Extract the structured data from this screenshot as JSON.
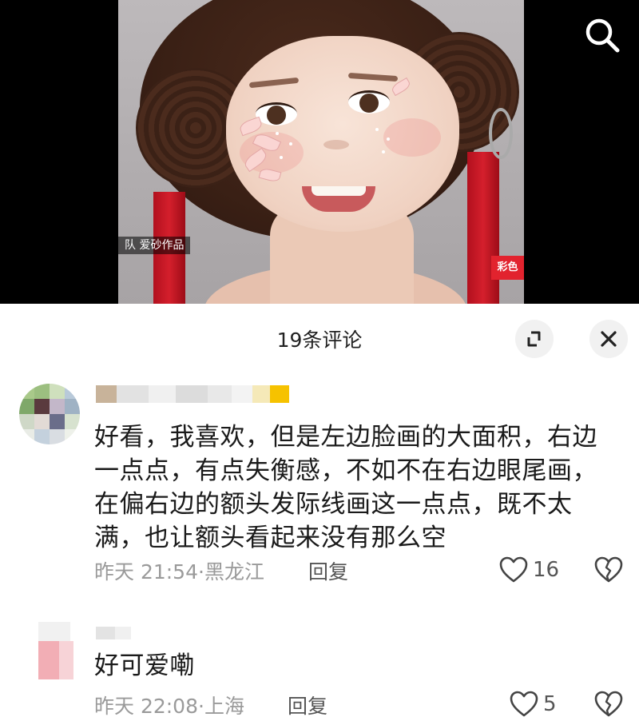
{
  "video": {
    "caption_left": "队 爱砂作品",
    "caption_right": "彩色"
  },
  "comments_sheet": {
    "title": "19条评论",
    "comments": [
      {
        "text_lines": [
          "好看，我喜欢，但是左边脸画的大面积，右边",
          "一点点，有点失衡感，不如不在右边眼尾画，",
          "在偏右边的额头发际线画这一点点，既不太",
          "满，也让额头看起来没有那么空"
        ],
        "time": "昨天 21:54",
        "separator": "·",
        "location": "黑龙江",
        "reply_label": "回复",
        "likes": "16"
      },
      {
        "text_lines": [
          "好可爱嘞"
        ],
        "time": "昨天 22:08",
        "separator": "·",
        "location": "上海",
        "reply_label": "回复",
        "likes": "5"
      }
    ]
  },
  "icons": {
    "search": "search-icon",
    "expand": "expand-icon",
    "close": "close-icon",
    "like": "heart-outline-icon",
    "dislike": "broken-heart-icon"
  },
  "colors": {
    "text_primary": "#1a1a1a",
    "text_meta": "#9a9a9a",
    "button_bg": "#f1f1f1",
    "ribbon_red": "#d41f2c"
  }
}
